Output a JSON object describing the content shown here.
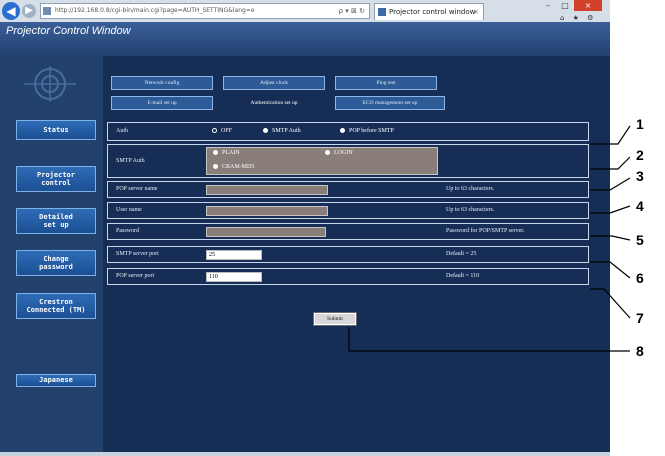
{
  "browser": {
    "address": "http://192.168.0.8/cgi-bin/main.cgi?page=AUTH_SETTING&lang=e",
    "tab_title": "Projector control window",
    "tab_close": "×",
    "address_tools": "ρ ▾ ⊠ ↻",
    "win_min": "–",
    "win_max": "□",
    "win_close": "×",
    "right_icons": "⌂ ★ ⚙"
  },
  "app": {
    "title": "Projector Control Window"
  },
  "sidebar": {
    "items": [
      {
        "label": "Status"
      },
      {
        "label": "Projector\ncontrol"
      },
      {
        "label": "Detailed\nset up"
      },
      {
        "label": "Change\npassword"
      },
      {
        "label": "Crestron\nConnected (TM)"
      },
      {
        "label": "Japanese"
      }
    ]
  },
  "tabs": {
    "row1": [
      {
        "label": "Network config"
      },
      {
        "label": "Adjust clock"
      },
      {
        "label": "Ping test"
      }
    ],
    "row2": [
      {
        "label": "E-mail set up"
      },
      {
        "label": "Authentication set up"
      },
      {
        "label": "ECO management set up"
      }
    ]
  },
  "form": {
    "auth": {
      "label": "Auth",
      "options": [
        "OFF",
        "SMTP Auth",
        "POP before SMTP"
      ]
    },
    "smtp_auth": {
      "label": "SMTP Auth",
      "options": [
        "PLAIN",
        "LOGIN",
        "CRAM-MD5"
      ]
    },
    "pop_server_name": {
      "label": "POP server name",
      "note": "Up to 63 characters."
    },
    "user_name": {
      "label": "User name",
      "note": "Up to 63 characters."
    },
    "password": {
      "label": "Password",
      "note": "Password for POP/SMTP server."
    },
    "smtp_server_port": {
      "label": "SMTP server port",
      "value": "25",
      "note": "Default = 25"
    },
    "pop_server_port": {
      "label": "POP server port",
      "value": "110",
      "note": "Default = 110"
    },
    "submit_label": "Submit"
  },
  "callouts": [
    "1",
    "2",
    "3",
    "4",
    "5",
    "6",
    "7",
    "8"
  ]
}
